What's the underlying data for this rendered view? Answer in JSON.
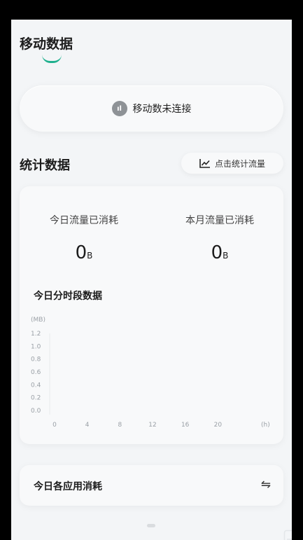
{
  "header": {
    "title": "移动数据"
  },
  "connection": {
    "icon": "cellular-signal-icon",
    "icon_glyph": "ıl",
    "status": "移动数未连接"
  },
  "stats": {
    "heading": "统计数据",
    "button_label": "点击统计流量",
    "button_icon": "line-chart-icon",
    "today_label": "今日流量已消耗",
    "today_value": "0",
    "today_unit": "B",
    "month_label": "本月流量已消耗",
    "month_value": "0",
    "month_unit": "B",
    "chart_title": "今日分时段数据"
  },
  "chart_data": {
    "type": "bar",
    "ylabel": "(MB)",
    "xlabel": "(h)",
    "x_ticks": [
      "0",
      "4",
      "8",
      "12",
      "16",
      "20"
    ],
    "y_ticks": [
      "0.0",
      "0.2",
      "0.4",
      "0.6",
      "0.8",
      "1.0",
      "1.2"
    ],
    "ylim": [
      0,
      1.2
    ],
    "xlim": [
      0,
      24
    ],
    "categories": [],
    "values": []
  },
  "apps": {
    "label": "今日各应用消耗",
    "switch_icon": "swap-arrows-icon",
    "switch_glyph": "⇋"
  },
  "colors": {
    "accent": "#1fb08e",
    "background": "#f3f5f7",
    "card": "#f8f9fa"
  }
}
